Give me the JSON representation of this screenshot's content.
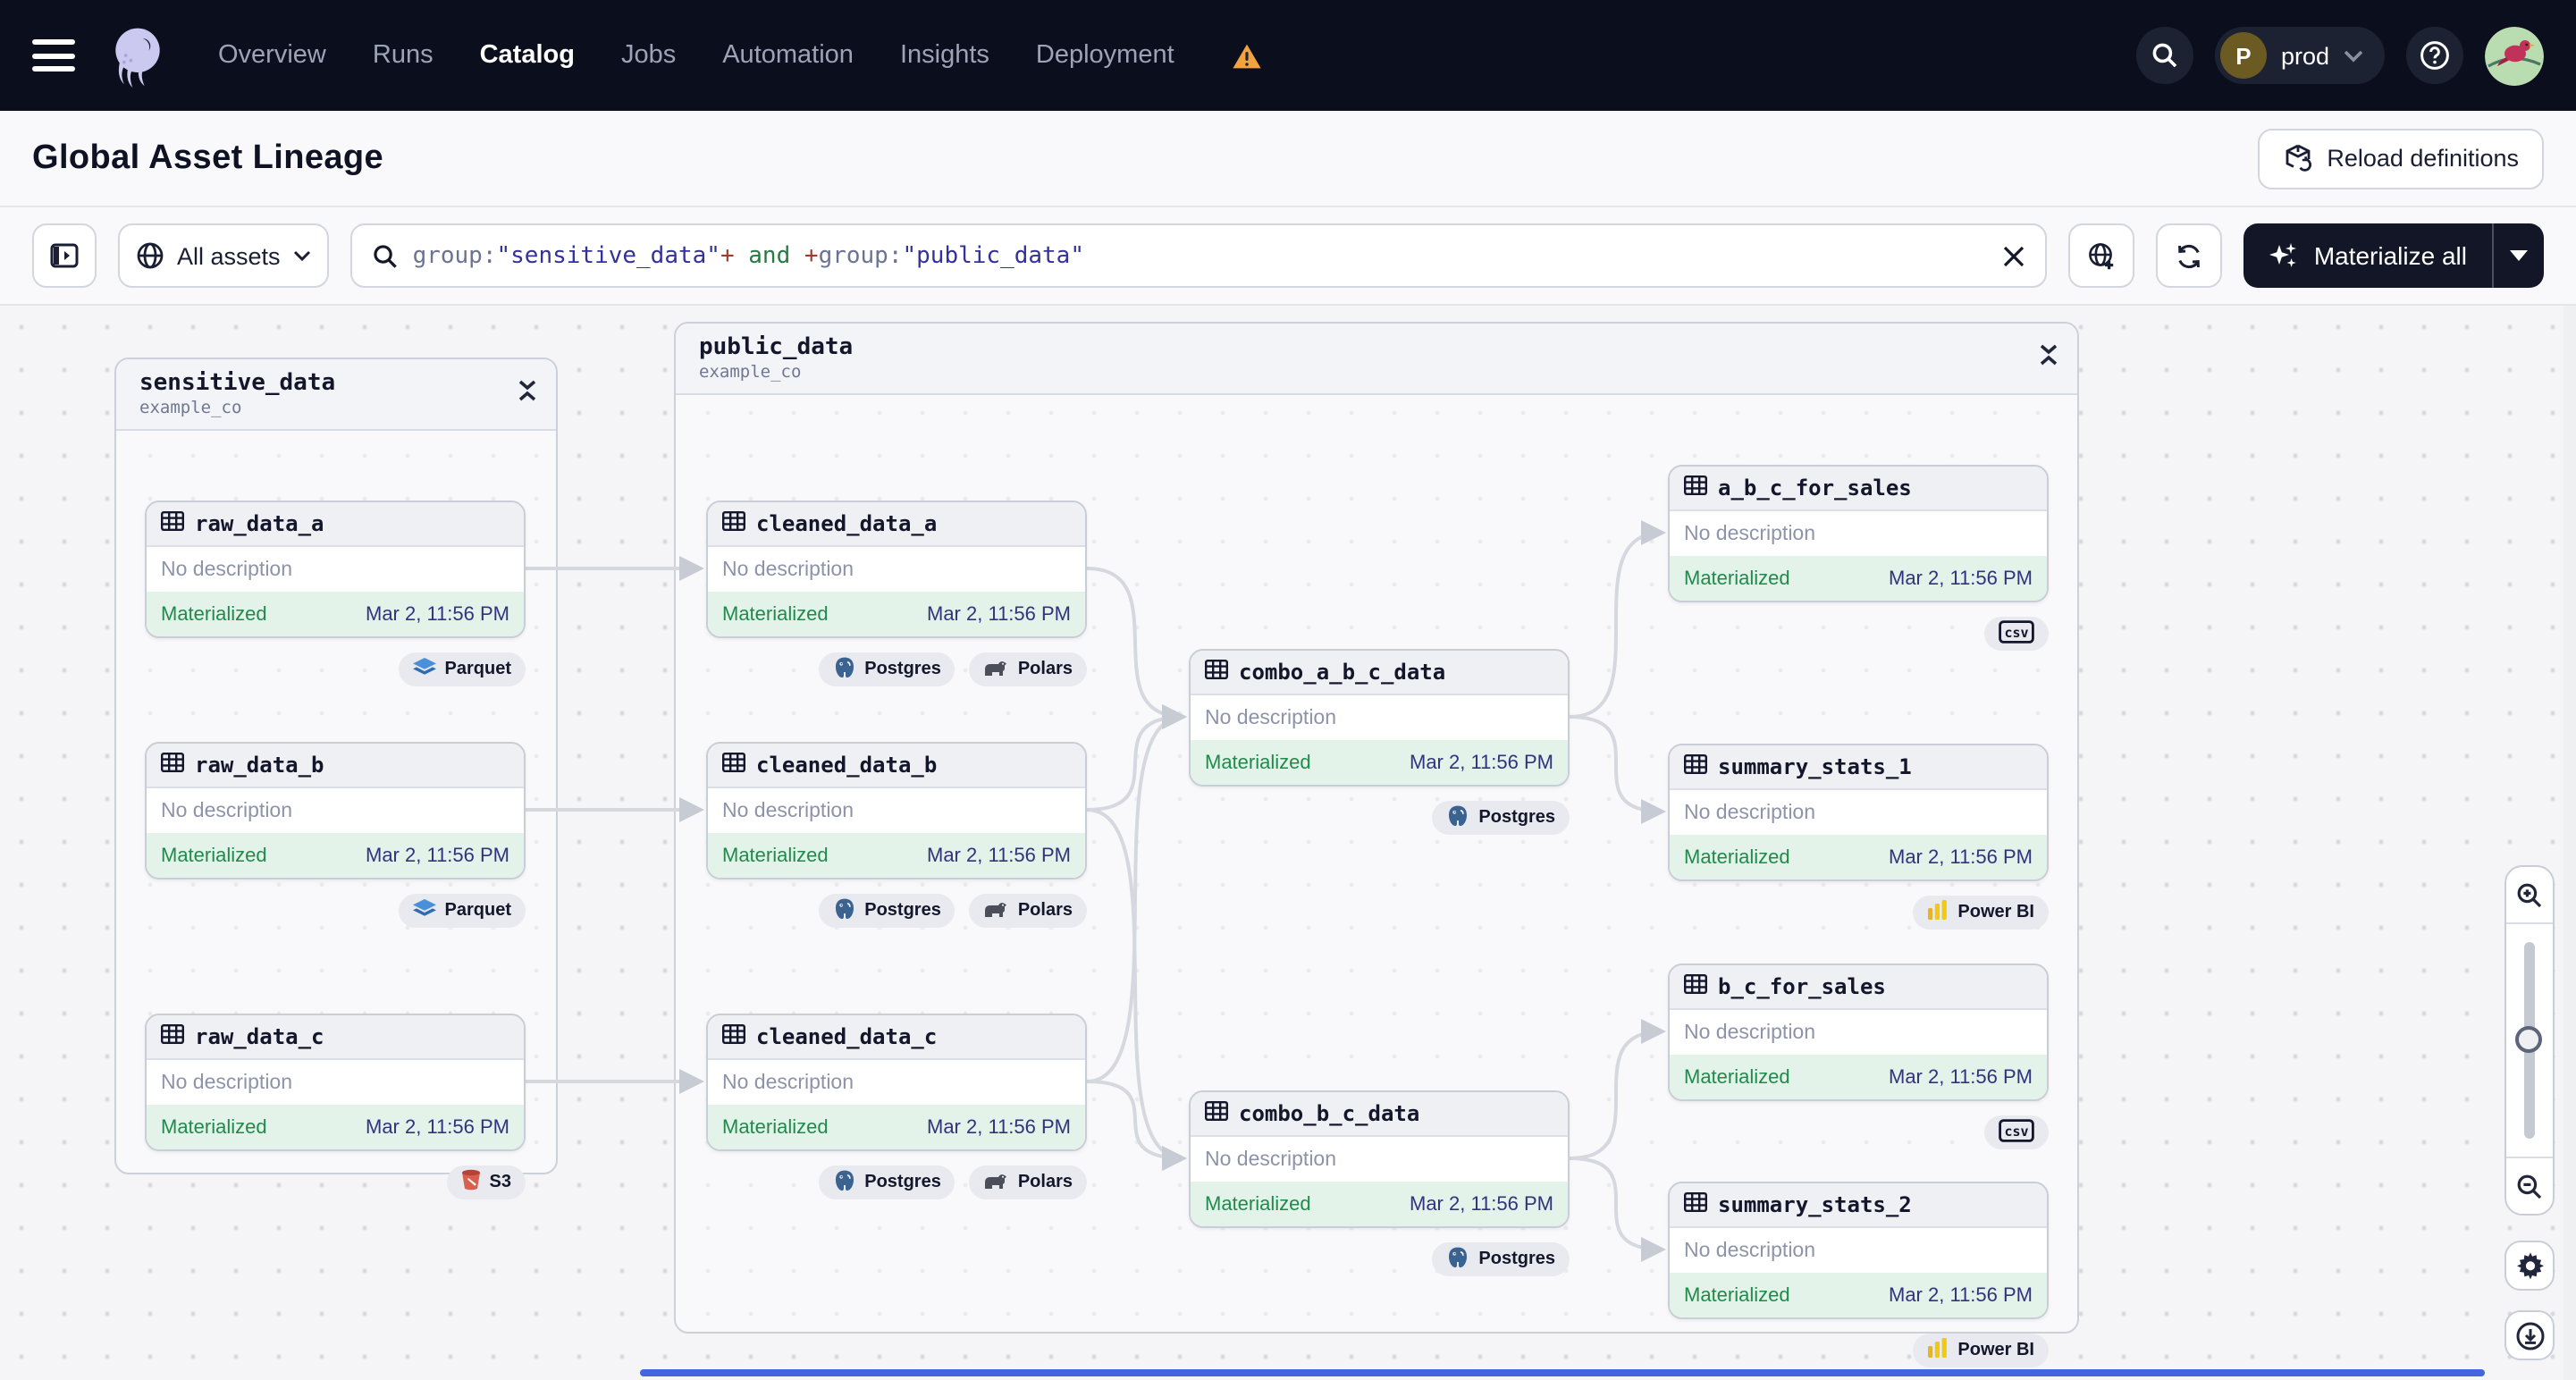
{
  "nav": {
    "items": [
      {
        "label": "Overview"
      },
      {
        "label": "Runs"
      },
      {
        "label": "Catalog"
      },
      {
        "label": "Jobs"
      },
      {
        "label": "Automation"
      },
      {
        "label": "Insights"
      },
      {
        "label": "Deployment"
      }
    ],
    "active": "Catalog",
    "deployment_warning": true,
    "environment": {
      "initial": "P",
      "label": "prod"
    }
  },
  "page_header": {
    "title": "Global Asset Lineage",
    "reload_label": "Reload definitions"
  },
  "toolbar": {
    "scope_label": "All assets",
    "query_tokens": [
      {
        "t": "group:",
        "c": "attr"
      },
      {
        "t": "\"sensitive_data\"",
        "c": "val"
      },
      {
        "t": "+",
        "c": "op"
      },
      {
        "t": " and ",
        "c": "kw"
      },
      {
        "t": "+",
        "c": "op"
      },
      {
        "t": "group:",
        "c": "attr"
      },
      {
        "t": "\"public_data\"",
        "c": "val"
      }
    ],
    "materialize_label": "Materialize all"
  },
  "lineage": {
    "groups": [
      {
        "id": "sensitive_data",
        "name": "sensitive_data",
        "repo": "example_co",
        "nodes": [
          {
            "id": "raw_data_a",
            "name": "raw_data_a",
            "description": "No description",
            "status": "Materialized",
            "timestamp": "Mar 2, 11:56 PM",
            "tags": [
              {
                "label": "Parquet",
                "icon": "parquet"
              }
            ]
          },
          {
            "id": "raw_data_b",
            "name": "raw_data_b",
            "description": "No description",
            "status": "Materialized",
            "timestamp": "Mar 2, 11:56 PM",
            "tags": [
              {
                "label": "Parquet",
                "icon": "parquet"
              }
            ]
          },
          {
            "id": "raw_data_c",
            "name": "raw_data_c",
            "description": "No description",
            "status": "Materialized",
            "timestamp": "Mar 2, 11:56 PM",
            "tags": [
              {
                "label": "S3",
                "icon": "s3"
              }
            ]
          }
        ]
      },
      {
        "id": "public_data",
        "name": "public_data",
        "repo": "example_co",
        "nodes": [
          {
            "id": "cleaned_data_a",
            "name": "cleaned_data_a",
            "description": "No description",
            "status": "Materialized",
            "timestamp": "Mar 2, 11:56 PM",
            "tags": [
              {
                "label": "Postgres",
                "icon": "postgres"
              },
              {
                "label": "Polars",
                "icon": "polars"
              }
            ]
          },
          {
            "id": "cleaned_data_b",
            "name": "cleaned_data_b",
            "description": "No description",
            "status": "Materialized",
            "timestamp": "Mar 2, 11:56 PM",
            "tags": [
              {
                "label": "Postgres",
                "icon": "postgres"
              },
              {
                "label": "Polars",
                "icon": "polars"
              }
            ]
          },
          {
            "id": "cleaned_data_c",
            "name": "cleaned_data_c",
            "description": "No description",
            "status": "Materialized",
            "timestamp": "Mar 2, 11:56 PM",
            "tags": [
              {
                "label": "Postgres",
                "icon": "postgres"
              },
              {
                "label": "Polars",
                "icon": "polars"
              }
            ]
          },
          {
            "id": "combo_a_b_c_data",
            "name": "combo_a_b_c_data",
            "description": "No description",
            "status": "Materialized",
            "timestamp": "Mar 2, 11:56 PM",
            "tags": [
              {
                "label": "Postgres",
                "icon": "postgres"
              }
            ]
          },
          {
            "id": "combo_b_c_data",
            "name": "combo_b_c_data",
            "description": "No description",
            "status": "Materialized",
            "timestamp": "Mar 2, 11:56 PM",
            "tags": [
              {
                "label": "Postgres",
                "icon": "postgres"
              }
            ]
          },
          {
            "id": "a_b_c_for_sales",
            "name": "a_b_c_for_sales",
            "description": "No description",
            "status": "Materialized",
            "timestamp": "Mar 2, 11:56 PM",
            "tags": [
              {
                "label": "",
                "icon": "csv"
              }
            ]
          },
          {
            "id": "summary_stats_1",
            "name": "summary_stats_1",
            "description": "No description",
            "status": "Materialized",
            "timestamp": "Mar 2, 11:56 PM",
            "tags": [
              {
                "label": "Power BI",
                "icon": "powerbi"
              }
            ]
          },
          {
            "id": "b_c_for_sales",
            "name": "b_c_for_sales",
            "description": "No description",
            "status": "Materialized",
            "timestamp": "Mar 2, 11:56 PM",
            "tags": [
              {
                "label": "",
                "icon": "csv"
              }
            ]
          },
          {
            "id": "summary_stats_2",
            "name": "summary_stats_2",
            "description": "No description",
            "status": "Materialized",
            "timestamp": "Mar 2, 11:56 PM",
            "tags": [
              {
                "label": "Power BI",
                "icon": "powerbi"
              }
            ]
          }
        ]
      }
    ],
    "edges": [
      [
        "raw_data_a",
        "cleaned_data_a"
      ],
      [
        "raw_data_b",
        "cleaned_data_b"
      ],
      [
        "raw_data_c",
        "cleaned_data_c"
      ],
      [
        "cleaned_data_a",
        "combo_a_b_c_data"
      ],
      [
        "cleaned_data_b",
        "combo_a_b_c_data"
      ],
      [
        "cleaned_data_c",
        "combo_a_b_c_data"
      ],
      [
        "cleaned_data_b",
        "combo_b_c_data"
      ],
      [
        "cleaned_data_c",
        "combo_b_c_data"
      ],
      [
        "combo_a_b_c_data",
        "a_b_c_for_sales"
      ],
      [
        "combo_a_b_c_data",
        "summary_stats_1"
      ],
      [
        "combo_b_c_data",
        "b_c_for_sales"
      ],
      [
        "combo_b_c_data",
        "summary_stats_2"
      ]
    ]
  },
  "colors": {
    "navbar_bg": "#0b0e1d",
    "accent_dark": "#121626",
    "status_green": "#1f8a4c",
    "status_green_bg": "#e4f3e9",
    "timestamp_indigo": "#32327e",
    "warning_orange": "#f0a33f",
    "edge_gray": "#d5d8df",
    "scrollbar_blue": "#4465e0",
    "query_attr": "#6b7394",
    "query_value": "#333299",
    "query_operator": "#9c3b2e",
    "query_keyword": "#267a44"
  }
}
